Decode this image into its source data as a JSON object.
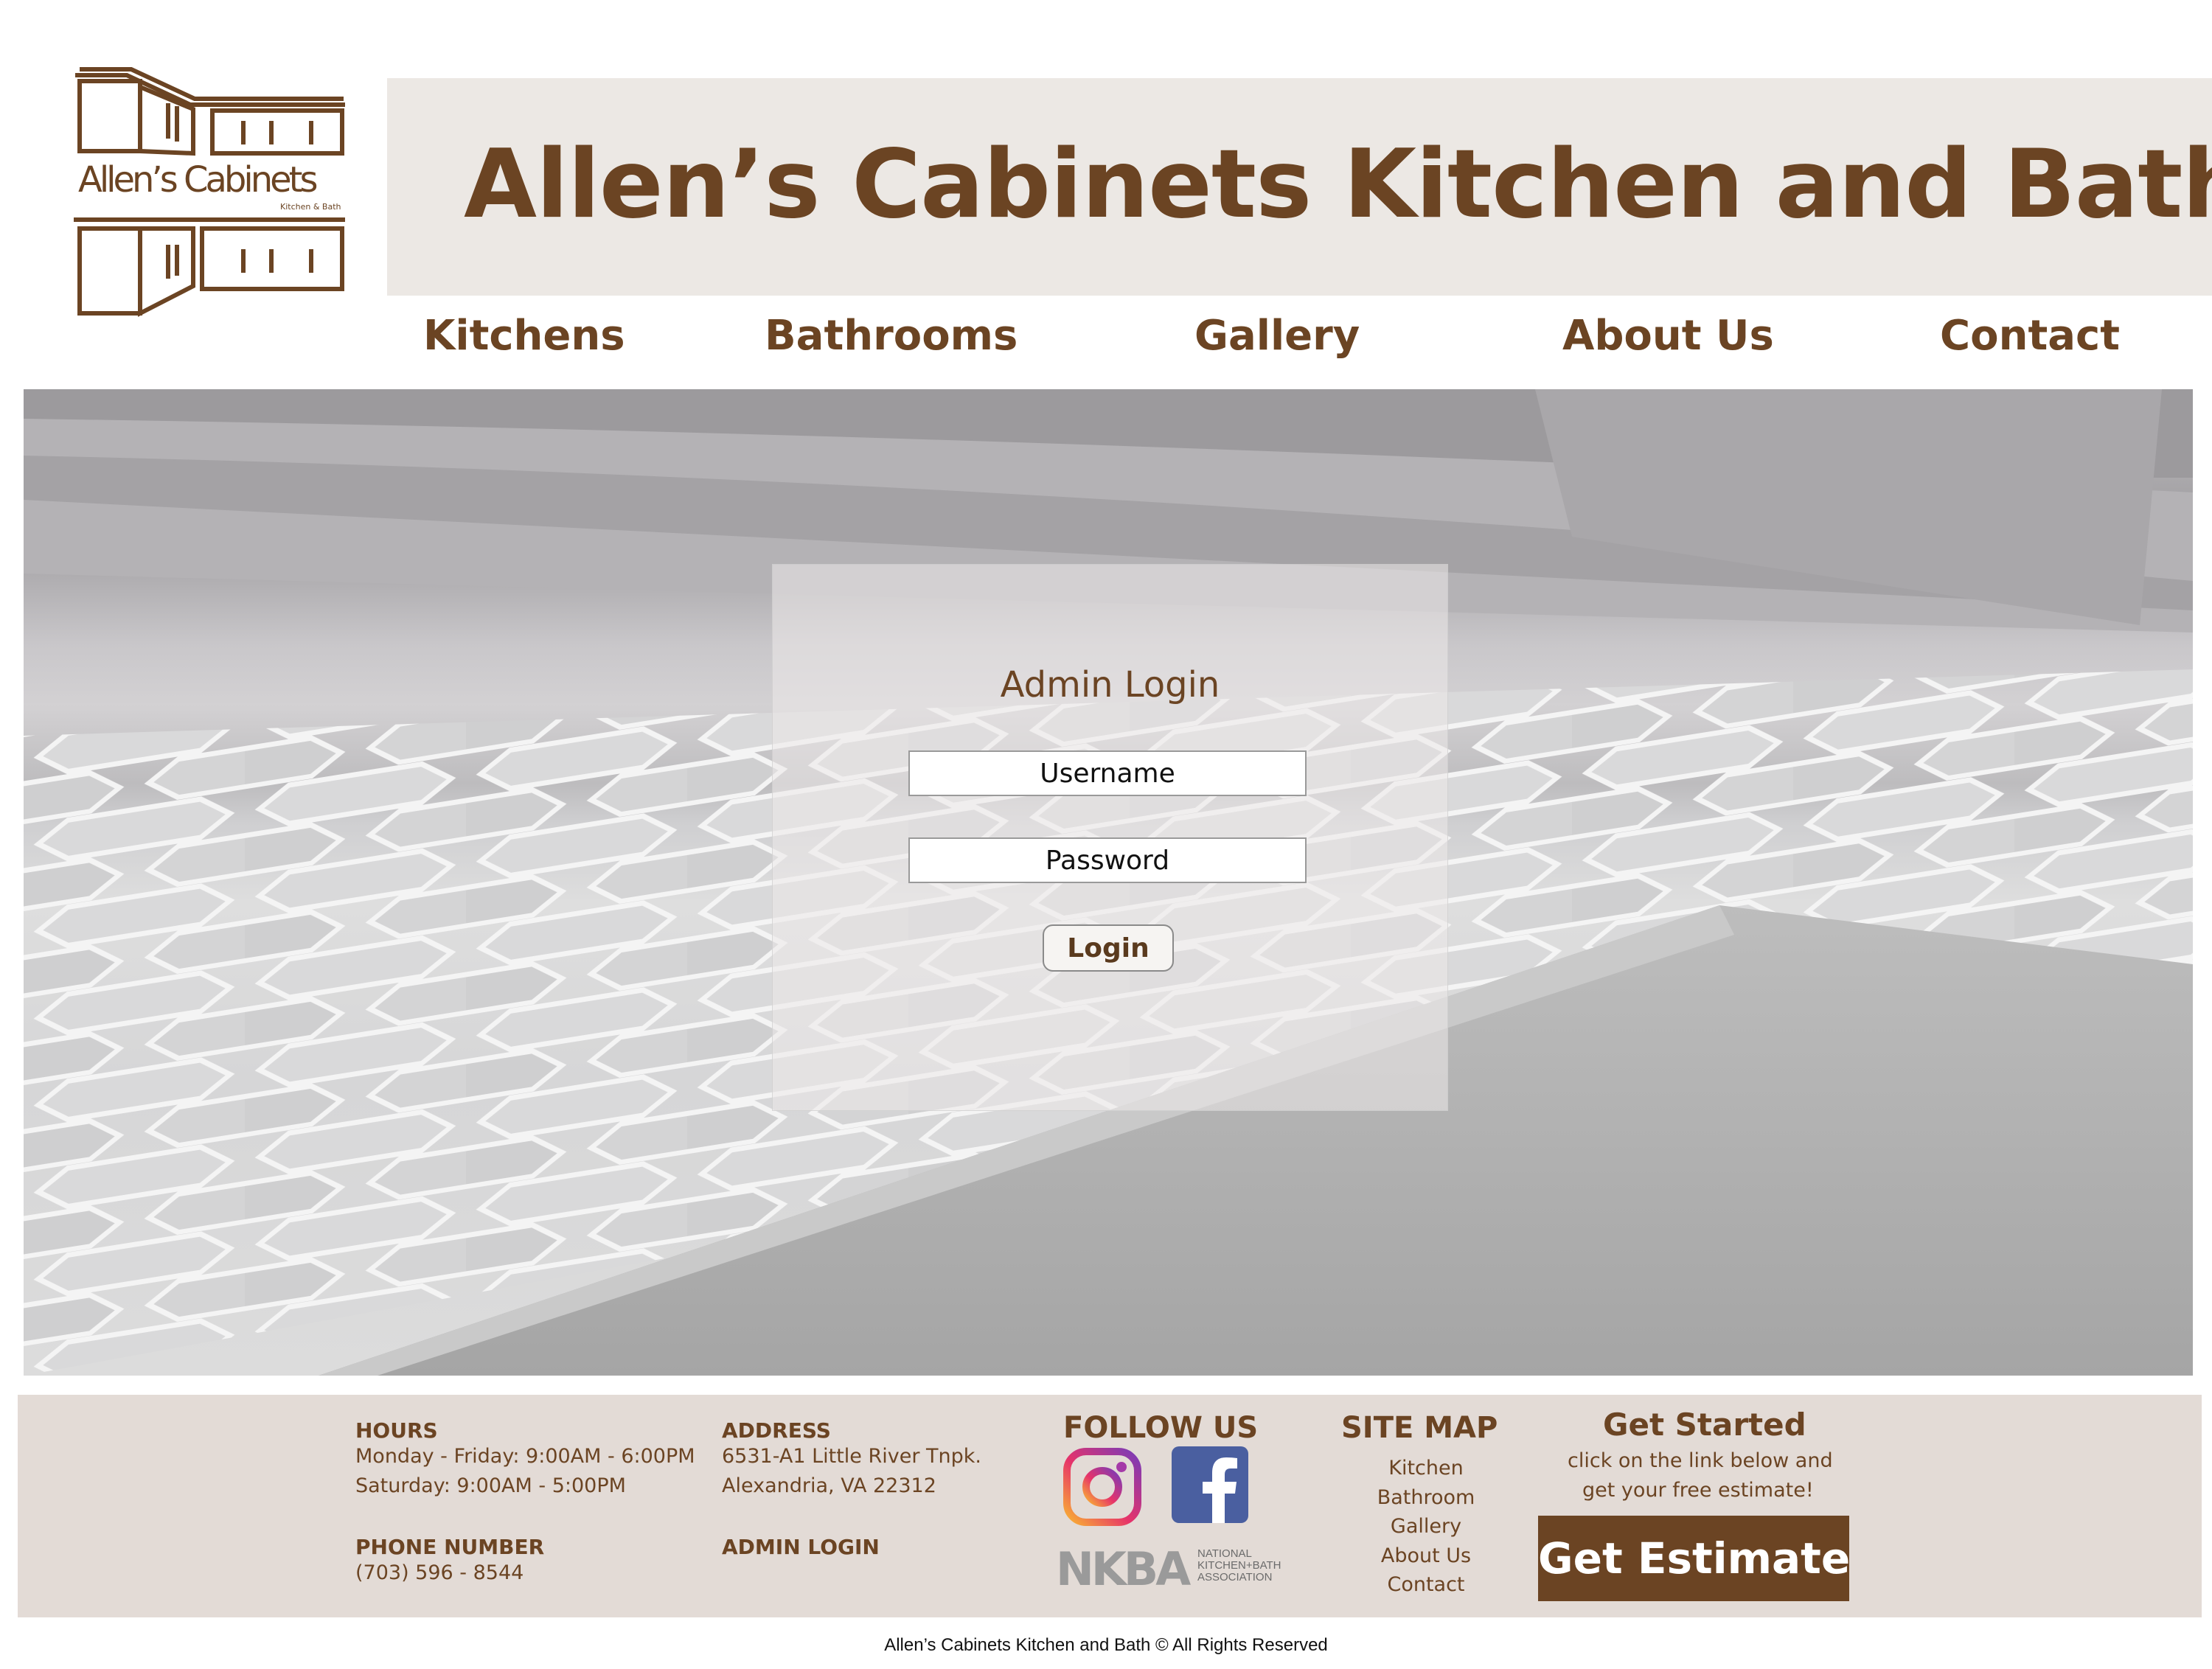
{
  "brand": {
    "logo_text": "Allen’s Cabinets",
    "logo_subtext": "Kitchen & Bath",
    "title": "Allen’s Cabinets Kitchen and Bath",
    "color": "#6b4423"
  },
  "nav": {
    "items": [
      {
        "label": "Kitchens"
      },
      {
        "label": "Bathrooms"
      },
      {
        "label": "Gallery"
      },
      {
        "label": "About Us"
      },
      {
        "label": "Contact"
      }
    ]
  },
  "login": {
    "title": "Admin Login",
    "username_placeholder": "Username",
    "password_placeholder": "Password",
    "button_label": "Login"
  },
  "footer": {
    "hours_heading": "HOURS",
    "hours_line1": "Monday - Friday: 9:00AM - 6:00PM",
    "hours_line2": "Saturday: 9:00AM - 5:00PM",
    "phone_heading": "PHONE NUMBER",
    "phone": "(703) 596 - 8544",
    "address_heading": "ADDRESS",
    "address_line1": "6531-A1 Little River Tnpk.",
    "address_line2": "Alexandria, VA 22312",
    "admin_login": "ADMIN LOGIN",
    "follow_heading": "FOLLOW US",
    "social_icons": [
      "instagram-icon",
      "facebook-icon"
    ],
    "nkba_logo_text": "NKBA",
    "nkba_caption_lines": [
      "NATIONAL",
      "KITCHEN+BATH",
      "ASSOCIATION"
    ],
    "sitemap_heading": "SITE MAP",
    "sitemap_links": [
      "Kitchen",
      "Bathroom",
      "Gallery",
      "About Us",
      "Contact"
    ],
    "get_started_heading": "Get Started",
    "get_started_line1": "click on the link below and",
    "get_started_line2": "get your free estimate!",
    "estimate_button": "Get Estimate"
  },
  "copyright": "Allen’s Cabinets Kitchen and Bath © All Rights Reserved",
  "colors": {
    "brand_brown": "#6b4423",
    "banner_bg": "#ece8e4",
    "footer_bg": "#e3dbd6"
  }
}
